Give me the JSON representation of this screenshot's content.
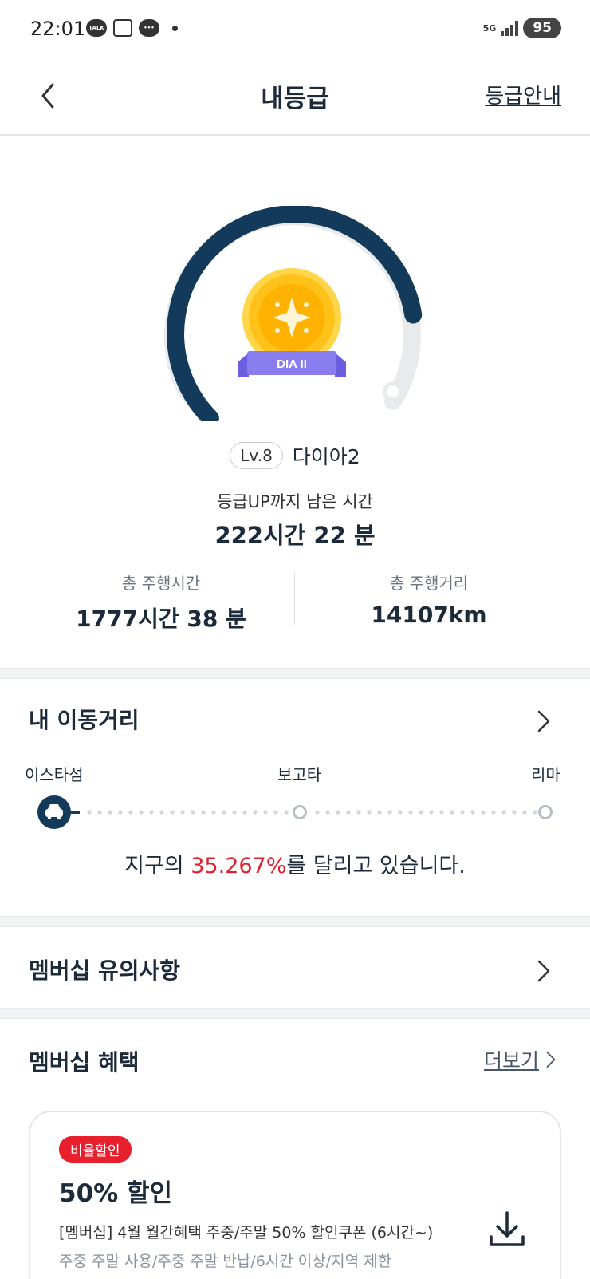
{
  "status_bar": {
    "time": "22:01",
    "talk": "TALK",
    "network": "5G",
    "battery": "95"
  },
  "header": {
    "title": "내등급",
    "guide_link": "등급안내"
  },
  "grade": {
    "badge_text": "DIA II",
    "level": "Lv.8",
    "name": "다이아2",
    "remaining_label": "등급UP까지 남은 시간",
    "remaining_value": "222시간 22 분",
    "progress_fraction": 0.8
  },
  "stats": {
    "drive_time_label": "총 주행시간",
    "drive_time_value": "1777시간 38 분",
    "distance_label": "총 주행거리",
    "distance_value": "14107km"
  },
  "distance_section": {
    "title": "내 이동거리",
    "stops": [
      "이스타섬",
      "보고타",
      "리마"
    ],
    "text_prefix": "지구의 ",
    "percent": "35.267%",
    "text_suffix": "를 달리고 있습니다."
  },
  "notice_section": {
    "title": "멤버십 유의사항"
  },
  "benefits": {
    "title": "멤버십 혜택",
    "more_label": "더보기",
    "card": {
      "badge": "비율할인",
      "title": "50% 할인",
      "description": "[멤버십] 4월 월간혜택 주중/주말 50% 할인쿠폰 (6시간~)",
      "conditions": "주중 주말 사용/주중 주말 반납/6시간 이상/지역 제한"
    }
  }
}
